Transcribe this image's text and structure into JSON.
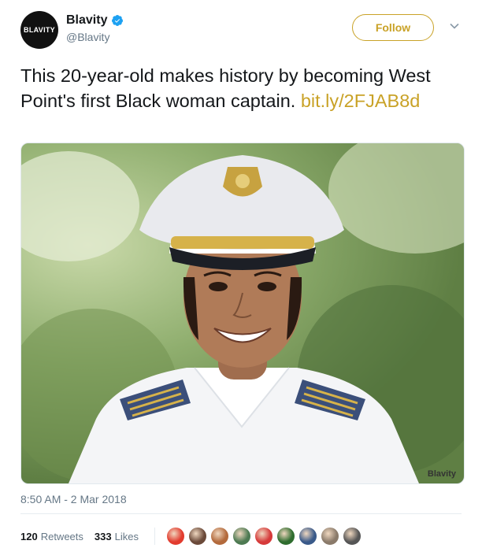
{
  "account": {
    "avatar_text": "BLAVITY",
    "display_name": "Blavity",
    "handle": "@Blavity",
    "verified_icon": "verified-badge-icon"
  },
  "actions": {
    "follow_label": "Follow",
    "more_icon": "chevron-down-icon"
  },
  "tweet": {
    "text": "This 20-year-old makes history by becoming West Point's first Black woman captain. ",
    "link_text": "bit.ly/2FJAB8d",
    "link_color": "#c9a227"
  },
  "media": {
    "watermark": "Blavity"
  },
  "meta": {
    "timestamp": "8:50 AM - 2 Mar 2018"
  },
  "stats": {
    "retweets_count": "120",
    "retweets_label": "Retweets",
    "likes_count": "333",
    "likes_label": "Likes"
  },
  "likers": [
    {
      "color": "#e23b2e"
    },
    {
      "color": "#6b4a3a"
    },
    {
      "color": "#b36a3c"
    },
    {
      "color": "#4d7a52"
    },
    {
      "color": "#d63a3a"
    },
    {
      "color": "#2f6d2f"
    },
    {
      "color": "#3a5a8a"
    },
    {
      "color": "#8a7a6a"
    },
    {
      "color": "#555555"
    }
  ]
}
